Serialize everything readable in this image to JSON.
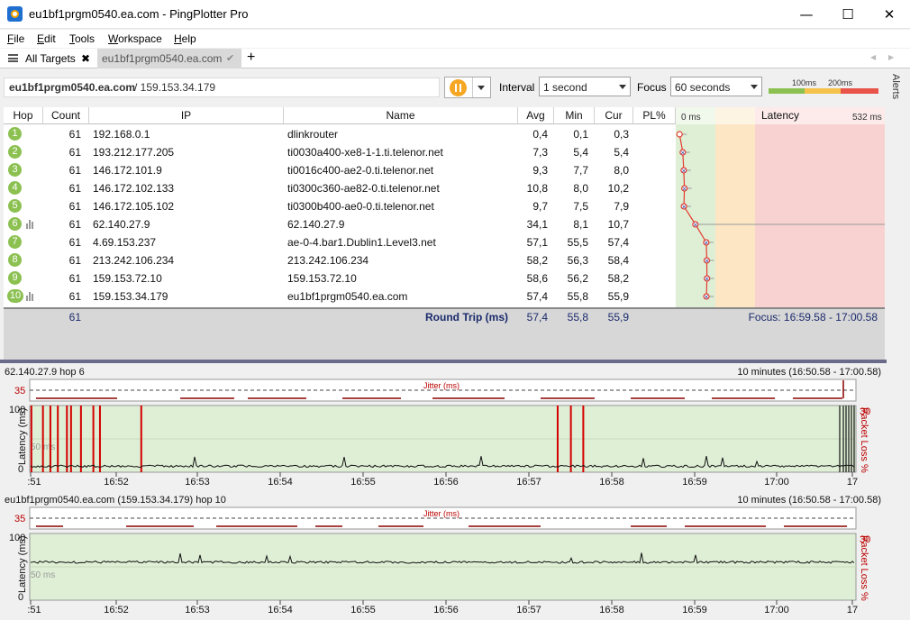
{
  "window": {
    "title": "eu1bf1prgm0540.ea.com - PingPlotter Pro",
    "minimize": "—",
    "maximize": "☐",
    "close": "✕"
  },
  "menu": [
    "File",
    "Edit",
    "Tools",
    "Workspace",
    "Help"
  ],
  "menu_underline": [
    "F",
    "E",
    "T",
    "W",
    "H"
  ],
  "tabs": {
    "all_label": "All Targets",
    "all_close": "✖",
    "target_label": "eu1bf1prgm0540.ea.com",
    "target_check": "✔",
    "add": "+",
    "nav_left": "◀",
    "nav_right": "▶"
  },
  "target": {
    "host": "eu1bf1prgm0540.ea.com",
    "ip_suffix": " / 159.153.34.179",
    "interval_label": "Interval",
    "interval_value": "1 second",
    "focus_label": "Focus",
    "focus_value": "60 seconds",
    "legend_100": "100ms",
    "legend_200": "200ms"
  },
  "alerts_label": "Alerts",
  "table": {
    "headers": {
      "hop": "Hop",
      "count": "Count",
      "ip": "IP",
      "name": "Name",
      "avg": "Avg",
      "min": "Min",
      "cur": "Cur",
      "pl": "PL%",
      "latency_min": "0 ms",
      "latency": "Latency",
      "latency_max": "532 ms"
    },
    "rows": [
      {
        "hop": "1",
        "count": "61",
        "ip": "192.168.0.1",
        "name": "dlinkrouter",
        "avg": "0,4",
        "min": "0,1",
        "cur": "0,3",
        "lat": 0.4,
        "bars": false
      },
      {
        "hop": "2",
        "count": "61",
        "ip": "193.212.177.205",
        "name": "ti0030a400-xe8-1-1.ti.telenor.net",
        "avg": "7,3",
        "min": "5,4",
        "cur": "5,4",
        "lat": 7.3,
        "bars": false
      },
      {
        "hop": "3",
        "count": "61",
        "ip": "146.172.101.9",
        "name": "ti0016c400-ae2-0.ti.telenor.net",
        "avg": "9,3",
        "min": "7,7",
        "cur": "8,0",
        "lat": 9.3,
        "bars": false
      },
      {
        "hop": "4",
        "count": "61",
        "ip": "146.172.102.133",
        "name": "ti0300c360-ae82-0.ti.telenor.net",
        "avg": "10,8",
        "min": "8,0",
        "cur": "10,2",
        "lat": 10.8,
        "bars": false
      },
      {
        "hop": "5",
        "count": "61",
        "ip": "146.172.105.102",
        "name": "ti0300b400-ae0-0.ti.telenor.net",
        "avg": "9,7",
        "min": "7,5",
        "cur": "7,9",
        "lat": 9.7,
        "bars": false
      },
      {
        "hop": "6",
        "count": "61",
        "ip": "62.140.27.9",
        "name": "62.140.27.9",
        "avg": "34,1",
        "min": "8,1",
        "cur": "10,7",
        "lat": 34.1,
        "bars": true
      },
      {
        "hop": "7",
        "count": "61",
        "ip": "4.69.153.237",
        "name": "ae-0-4.bar1.Dublin1.Level3.net",
        "avg": "57,1",
        "min": "55,5",
        "cur": "57,4",
        "lat": 57.1,
        "bars": false
      },
      {
        "hop": "8",
        "count": "61",
        "ip": "213.242.106.234",
        "name": "213.242.106.234",
        "avg": "58,2",
        "min": "56,3",
        "cur": "58,4",
        "lat": 58.2,
        "bars": false
      },
      {
        "hop": "9",
        "count": "61",
        "ip": "159.153.72.10",
        "name": "159.153.72.10",
        "avg": "58,6",
        "min": "56,2",
        "cur": "58,2",
        "lat": 58.6,
        "bars": false
      },
      {
        "hop": "10",
        "count": "61",
        "ip": "159.153.34.179",
        "name": "eu1bf1prgm0540.ea.com",
        "avg": "57,4",
        "min": "55,8",
        "cur": "55,9",
        "lat": 57.4,
        "bars": true
      }
    ],
    "summary": {
      "count": "61",
      "label": "Round Trip (ms)",
      "avg": "57,4",
      "min": "55,8",
      "cur": "55,9",
      "focus": "Focus: 16:59.58 - 17:00.58"
    }
  },
  "charts": [
    {
      "title": "62.140.27.9 hop 6",
      "range": "10 minutes (16:50.58 - 17:00.58)",
      "jitter_label": "Jitter (ms)",
      "jitter_tick": "35",
      "y_top": "100",
      "y_mid": "50 ms",
      "y_bottom": "0",
      "y_label": "Latency (ms)",
      "pl_top": "30",
      "pl_label": "Packet Loss %",
      "x_ticks": [
        ":51",
        "16:52",
        "16:53",
        "16:54",
        "16:55",
        "16:56",
        "16:57",
        "16:58",
        "16:59",
        "17:00",
        "17"
      ],
      "loss_events": [
        0.2,
        1.6,
        2.5,
        3.4,
        4.5,
        5.0,
        6.2,
        7.7,
        8.5,
        13.5,
        63.9,
        65.5,
        67.0
      ],
      "latency_baseline": 9
    },
    {
      "title": "eu1bf1prgm0540.ea.com (159.153.34.179) hop 10",
      "range": "10 minutes (16:50.58 - 17:00.58)",
      "jitter_label": "Jitter (ms)",
      "jitter_tick": "35",
      "y_top": "100",
      "y_mid": "50 ms",
      "y_bottom": "0",
      "y_label": "Latency (ms)",
      "pl_top": "30",
      "pl_label": "Packet Loss %",
      "x_ticks": [
        ":51",
        "16:52",
        "16:53",
        "16:54",
        "16:55",
        "16:56",
        "16:57",
        "16:58",
        "16:59",
        "17:00",
        "17"
      ],
      "loss_events": [],
      "latency_baseline": 57
    }
  ],
  "colors": {
    "good": "#dfefd5",
    "warn": "#fde6c4",
    "bad": "#f8d2d0",
    "loss": "#d40000",
    "hop": "#8cc152",
    "orange": "#f5a623"
  }
}
